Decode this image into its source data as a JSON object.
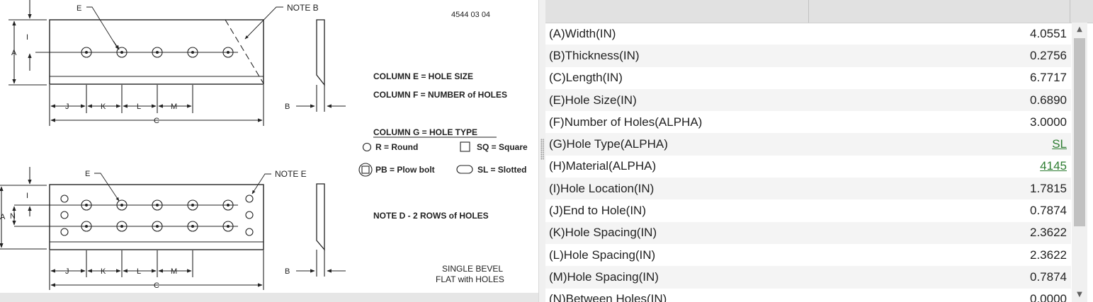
{
  "drawing": {
    "doc_number": "4544 03 04",
    "top_view": {
      "label_E": "E",
      "label_note_b": "NOTE B",
      "label_A": "A",
      "label_I": "I",
      "label_B": "B",
      "label_C": "C",
      "dims": [
        "J",
        "K",
        "L",
        "M"
      ]
    },
    "bottom_view": {
      "label_E": "E",
      "label_note_e": "NOTE E",
      "label_A": "A",
      "label_I": "I",
      "label_N": "N",
      "label_B": "B",
      "label_C": "C",
      "dims": [
        "J",
        "K",
        "L",
        "M"
      ]
    },
    "legend": {
      "column_e": "COLUMN  E  =  HOLE SIZE",
      "column_f": "COLUMN  F  =  NUMBER of HOLES",
      "column_g": "COLUMN  G  =  HOLE TYPE",
      "round": "R = Round",
      "square": "SQ = Square",
      "plow_bolt": "PB = Plow bolt",
      "slotted": "SL = Slotted",
      "note_d": "NOTE  D  -  2  ROWS of HOLES",
      "caption_1": "SINGLE  BEVEL",
      "caption_2": "FLAT with HOLES"
    }
  },
  "properties": {
    "rows": [
      {
        "name": "(A)Width(IN)",
        "value": "4.0551",
        "link": false
      },
      {
        "name": "(B)Thickness(IN)",
        "value": "0.2756",
        "link": false
      },
      {
        "name": "(C)Length(IN)",
        "value": "6.7717",
        "link": false
      },
      {
        "name": "(E)Hole Size(IN)",
        "value": "0.6890",
        "link": false
      },
      {
        "name": "(F)Number of Holes(ALPHA)",
        "value": "3.0000",
        "link": false
      },
      {
        "name": "(G)Hole Type(ALPHA)",
        "value": "SL",
        "link": true
      },
      {
        "name": "(H)Material(ALPHA)",
        "value": "4145",
        "link": true
      },
      {
        "name": "(I)Hole Location(IN)",
        "value": "1.7815",
        "link": false
      },
      {
        "name": "(J)End to Hole(IN)",
        "value": "0.7874",
        "link": false
      },
      {
        "name": "(K)Hole Spacing(IN)",
        "value": "2.3622",
        "link": false
      },
      {
        "name": "(L)Hole Spacing(IN)",
        "value": "2.3622",
        "link": false
      },
      {
        "name": "(M)Hole Spacing(IN)",
        "value": "0.7874",
        "link": false
      },
      {
        "name": "(N)Between Holes(IN)",
        "value": "0.0000",
        "link": false
      }
    ],
    "scrollbar": {
      "up_icon": "chevron-up-icon",
      "down_icon": "chevron-down-icon"
    }
  },
  "colors": {
    "link": "#2e7d32",
    "header_bg": "#e1e1e1",
    "stripe": "#f4f4f4"
  }
}
